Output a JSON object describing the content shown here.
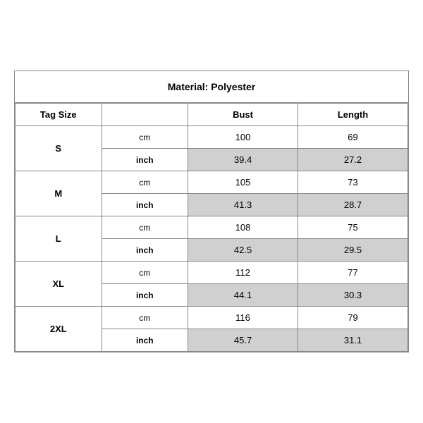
{
  "title": "Material: Polyester",
  "headers": {
    "tag_size": "Tag Size",
    "bust": "Bust",
    "length": "Length"
  },
  "sizes": [
    {
      "tag": "S",
      "cm_bust": "100",
      "cm_length": "69",
      "inch_bust": "39.4",
      "inch_length": "27.2"
    },
    {
      "tag": "M",
      "cm_bust": "105",
      "cm_length": "73",
      "inch_bust": "41.3",
      "inch_length": "28.7"
    },
    {
      "tag": "L",
      "cm_bust": "108",
      "cm_length": "75",
      "inch_bust": "42.5",
      "inch_length": "29.5"
    },
    {
      "tag": "XL",
      "cm_bust": "112",
      "cm_length": "77",
      "inch_bust": "44.1",
      "inch_length": "30.3"
    },
    {
      "tag": "2XL",
      "cm_bust": "116",
      "cm_length": "79",
      "inch_bust": "45.7",
      "inch_length": "31.1"
    }
  ],
  "unit_cm": "cm",
  "unit_inch": "inch"
}
